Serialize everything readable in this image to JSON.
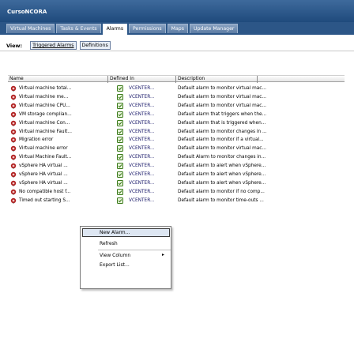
{
  "window": {
    "title": "CursoNCORA"
  },
  "tabs": [
    {
      "label": "Virtual Machines",
      "active": false
    },
    {
      "label": "Tasks & Events",
      "active": false
    },
    {
      "label": "Alarms",
      "active": true
    },
    {
      "label": "Permissions",
      "active": false
    },
    {
      "label": "Maps",
      "active": false
    },
    {
      "label": "Update Manager",
      "active": false
    }
  ],
  "view": {
    "label": "View:",
    "buttons": [
      {
        "label": "Triggered Alarms",
        "selected": true
      },
      {
        "label": "Definitions",
        "selected": false
      }
    ]
  },
  "grid": {
    "columns": [
      "Name",
      "Defined In",
      "Description"
    ],
    "rows": [
      {
        "name": "Virtual machine total...",
        "defined_in": "VCENTER...",
        "description": "Default alarm to monitor virtual mac..."
      },
      {
        "name": "Virtual machine me...",
        "defined_in": "VCENTER...",
        "description": "Default alarm to monitor virtual mac..."
      },
      {
        "name": "Virtual machine CPU...",
        "defined_in": "VCENTER...",
        "description": "Default alarm to monitor virtual mac..."
      },
      {
        "name": "VM storage complian...",
        "defined_in": "VCENTER...",
        "description": "Default alarm that triggers when the..."
      },
      {
        "name": "Virtual machine Con...",
        "defined_in": "VCENTER...",
        "description": "Default alarm that is triggered when..."
      },
      {
        "name": "Virtual machine Fault...",
        "defined_in": "VCENTER...",
        "description": "Default alarm to monitor changes in ..."
      },
      {
        "name": "Migration error",
        "defined_in": "VCENTER...",
        "description": "Default alarm to monitor if a virtual..."
      },
      {
        "name": "Virtual machine error",
        "defined_in": "VCENTER...",
        "description": "Default alarm to monitor virtual mac..."
      },
      {
        "name": "Virtual Machine Fault...",
        "defined_in": "VCENTER...",
        "description": "Default Alarm to monitor changes in..."
      },
      {
        "name": "vSphere HA virtual ...",
        "defined_in": "VCENTER...",
        "description": "Default alarm to alert when vSphere..."
      },
      {
        "name": "vSphere HA virtual ...",
        "defined_in": "VCENTER...",
        "description": "Default alarm to alert when vSphere..."
      },
      {
        "name": "vSphere HA virtual ...",
        "defined_in": "VCENTER...",
        "description": "Default alarm to alert when vSphere..."
      },
      {
        "name": "No compatible host f...",
        "defined_in": "VCENTER...",
        "description": "Default alarm to monitor if no comp..."
      },
      {
        "name": "Timed out starting S...",
        "defined_in": "VCENTER...",
        "description": "Default alarm to monitor time-outs ..."
      }
    ]
  },
  "context_menu": {
    "items": [
      {
        "label": "New Alarm...",
        "highlighted": true,
        "submenu": false
      },
      {
        "label": "Refresh",
        "highlighted": false,
        "submenu": false
      },
      {
        "label": "View Column",
        "highlighted": false,
        "submenu": true
      },
      {
        "label": "Export List...",
        "highlighted": false,
        "submenu": false
      }
    ],
    "submenu_arrow": "▸"
  },
  "icons": {
    "alarm": "alarm-bell-icon",
    "defined_in": "vcenter-icon"
  },
  "colors": {
    "title_bar": "#2c5687",
    "alarm_icon": "#b02020",
    "defined_icon": "#3a7a1a",
    "selection": "#dde6f2"
  }
}
